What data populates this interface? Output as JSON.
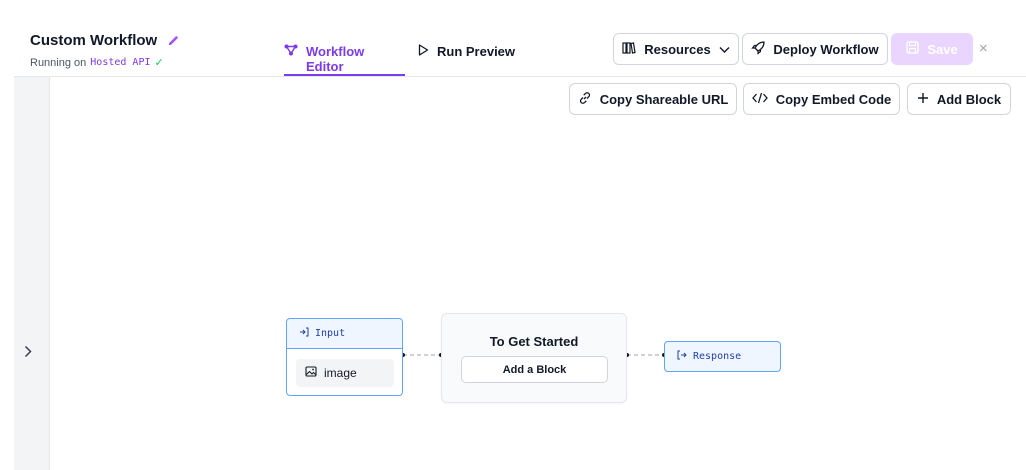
{
  "header": {
    "title": "Custom Workflow",
    "running_label": "Running on",
    "running_target": "Hosted API",
    "tabs": [
      {
        "label": "Workflow Editor",
        "active": true
      },
      {
        "label": "Run Preview",
        "active": false
      }
    ],
    "resources_label": "Resources",
    "deploy_label": "Deploy Workflow",
    "save_label": "Save"
  },
  "toolbar": {
    "share_label": "Copy Shareable URL",
    "embed_label": "Copy Embed Code",
    "add_label": "Add Block"
  },
  "nodes": {
    "input": {
      "title": "Input",
      "field": "image"
    },
    "start": {
      "title": "To Get Started",
      "button": "Add a Block"
    },
    "response": {
      "title": "Response"
    }
  },
  "icons": {
    "edit": "pencil-icon",
    "check": "check-icon",
    "workflow": "workflow-nodes-icon",
    "run": "play-icon",
    "resources": "books-icon",
    "deploy": "rocket-icon",
    "save": "save-icon",
    "close": "close-icon",
    "link": "link-icon",
    "code": "code-icon",
    "plus": "plus-icon",
    "chevron": "chevron-right-icon",
    "input": "arrow-into-icon",
    "image": "image-icon",
    "response": "arrow-out-icon"
  },
  "colors": {
    "accent": "#7c3aed",
    "node_border": "#60a5fa",
    "save_disabled": "#e9d5ff",
    "ok": "#22c55e"
  }
}
